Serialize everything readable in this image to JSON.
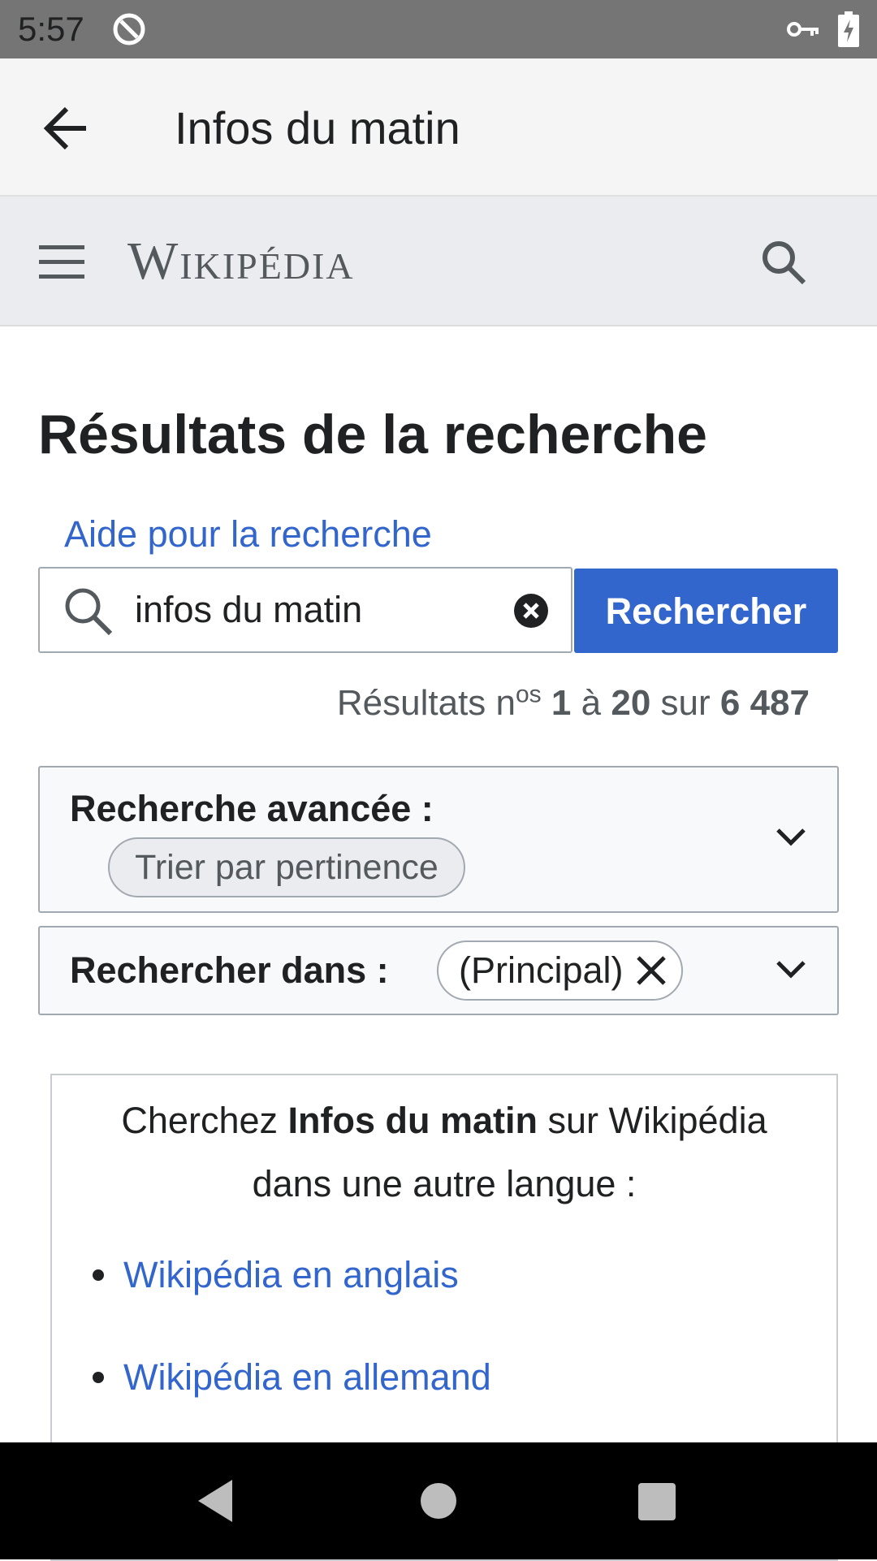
{
  "status_bar": {
    "time": "5:57",
    "icons": [
      "sync-icon",
      "vpn-key-icon",
      "battery-charging-icon"
    ]
  },
  "app_bar": {
    "title": "Infos du matin",
    "back_icon": "arrow-back-icon"
  },
  "wiki_header": {
    "logo_text": "Wikipédia",
    "menu_icon": "hamburger-icon",
    "search_icon": "search-icon"
  },
  "page": {
    "title": "Résultats de la recherche",
    "help_link": "Aide pour la recherche"
  },
  "search": {
    "query": "infos du matin",
    "button_label": "Rechercher"
  },
  "results": {
    "prefix": "Résultats n",
    "sup": "os",
    "from": "1",
    "word_a": "à",
    "to": "20",
    "word_sur": "sur",
    "total": "6 487"
  },
  "advanced": {
    "label": "Recherche avancée :",
    "chip": "Trier par pertinence"
  },
  "namespace": {
    "label": "Rechercher dans :",
    "chip": "(Principal)"
  },
  "other_languages": {
    "line1_before": "Cherchez ",
    "line1_bold": "Infos du matin",
    "line1_after": " sur Wikipédia",
    "line2": "dans une autre langue :",
    "links": [
      "Wikipédia en anglais",
      "Wikipédia en allemand"
    ]
  },
  "colors": {
    "accent": "#3366cc",
    "status_bar": "#757575",
    "app_bar": "#f5f5f5",
    "wiki_header": "#eaecf0"
  }
}
